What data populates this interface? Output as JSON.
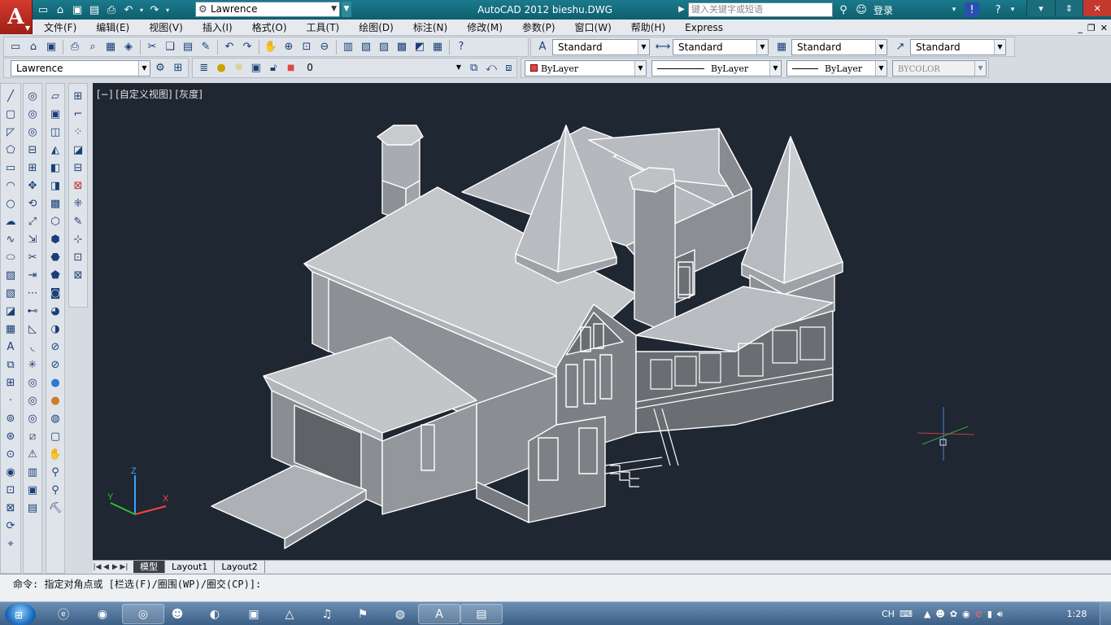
{
  "app": {
    "title": "AutoCAD 2012    bieshu.DWG",
    "workspace": "Lawrence",
    "search_placeholder": "键入关键字或短语",
    "login_label": "登录",
    "logo_letter": "A"
  },
  "menu": {
    "items": [
      "文件(F)",
      "编辑(E)",
      "视图(V)",
      "插入(I)",
      "格式(O)",
      "工具(T)",
      "绘图(D)",
      "标注(N)",
      "修改(M)",
      "参数(P)",
      "窗口(W)",
      "帮助(H)",
      "Express"
    ]
  },
  "styles_toolbar": {
    "text_style": "Standard",
    "dim_style": "Standard",
    "table_style": "Standard",
    "mleader_style": "Standard"
  },
  "layers_toolbar": {
    "workspace": "Lawrence",
    "current_layer": "0",
    "color": "ByLayer",
    "linetype": "ByLayer",
    "lineweight": "ByLayer",
    "plotstyle": "BYCOLOR"
  },
  "viewport": {
    "label": "[−] [自定义视图] [灰度]",
    "background": "#1f2733"
  },
  "layout_tabs": [
    "模型",
    "Layout1",
    "Layout2"
  ],
  "command": {
    "text": "命令: 指定对角点或 [栏选(F)/圈围(WP)/圈交(CP)]:"
  },
  "taskbar": {
    "clock": "1:28",
    "lang": "CH"
  }
}
